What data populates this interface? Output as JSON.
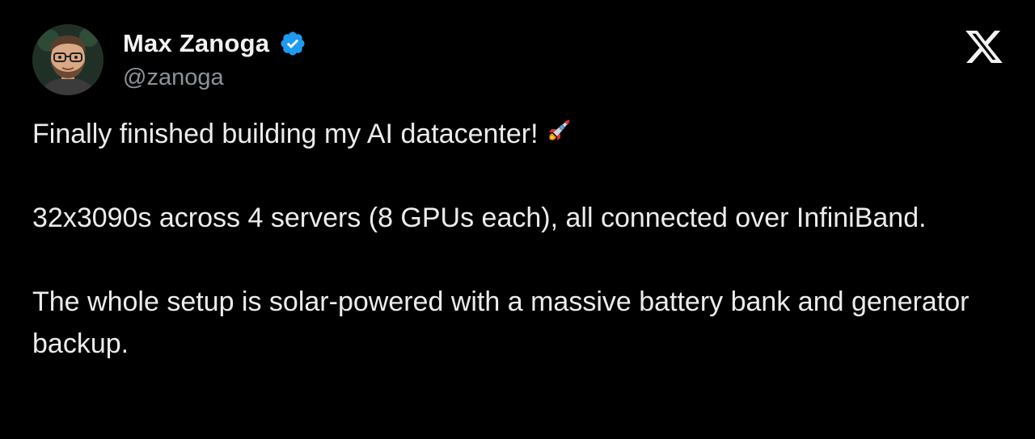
{
  "author": {
    "display_name": "Max Zanoga",
    "handle": "@zanoga",
    "verified_icon": "verified-badge-icon",
    "verified_color": "#1d9bf0"
  },
  "platform_icon": "x-logo-icon",
  "tweet": {
    "line1": "Finally finished building my AI datacenter!",
    "line1_emoji": "rocket-icon",
    "paragraph2": "32x3090s across 4 servers (8 GPUs each), all connected over InfiniBand.",
    "paragraph3": "The whole setup is solar-powered with a massive battery bank and generator backup."
  },
  "colors": {
    "background": "#000000",
    "text": "#ececec",
    "handle": "#8b9399"
  }
}
